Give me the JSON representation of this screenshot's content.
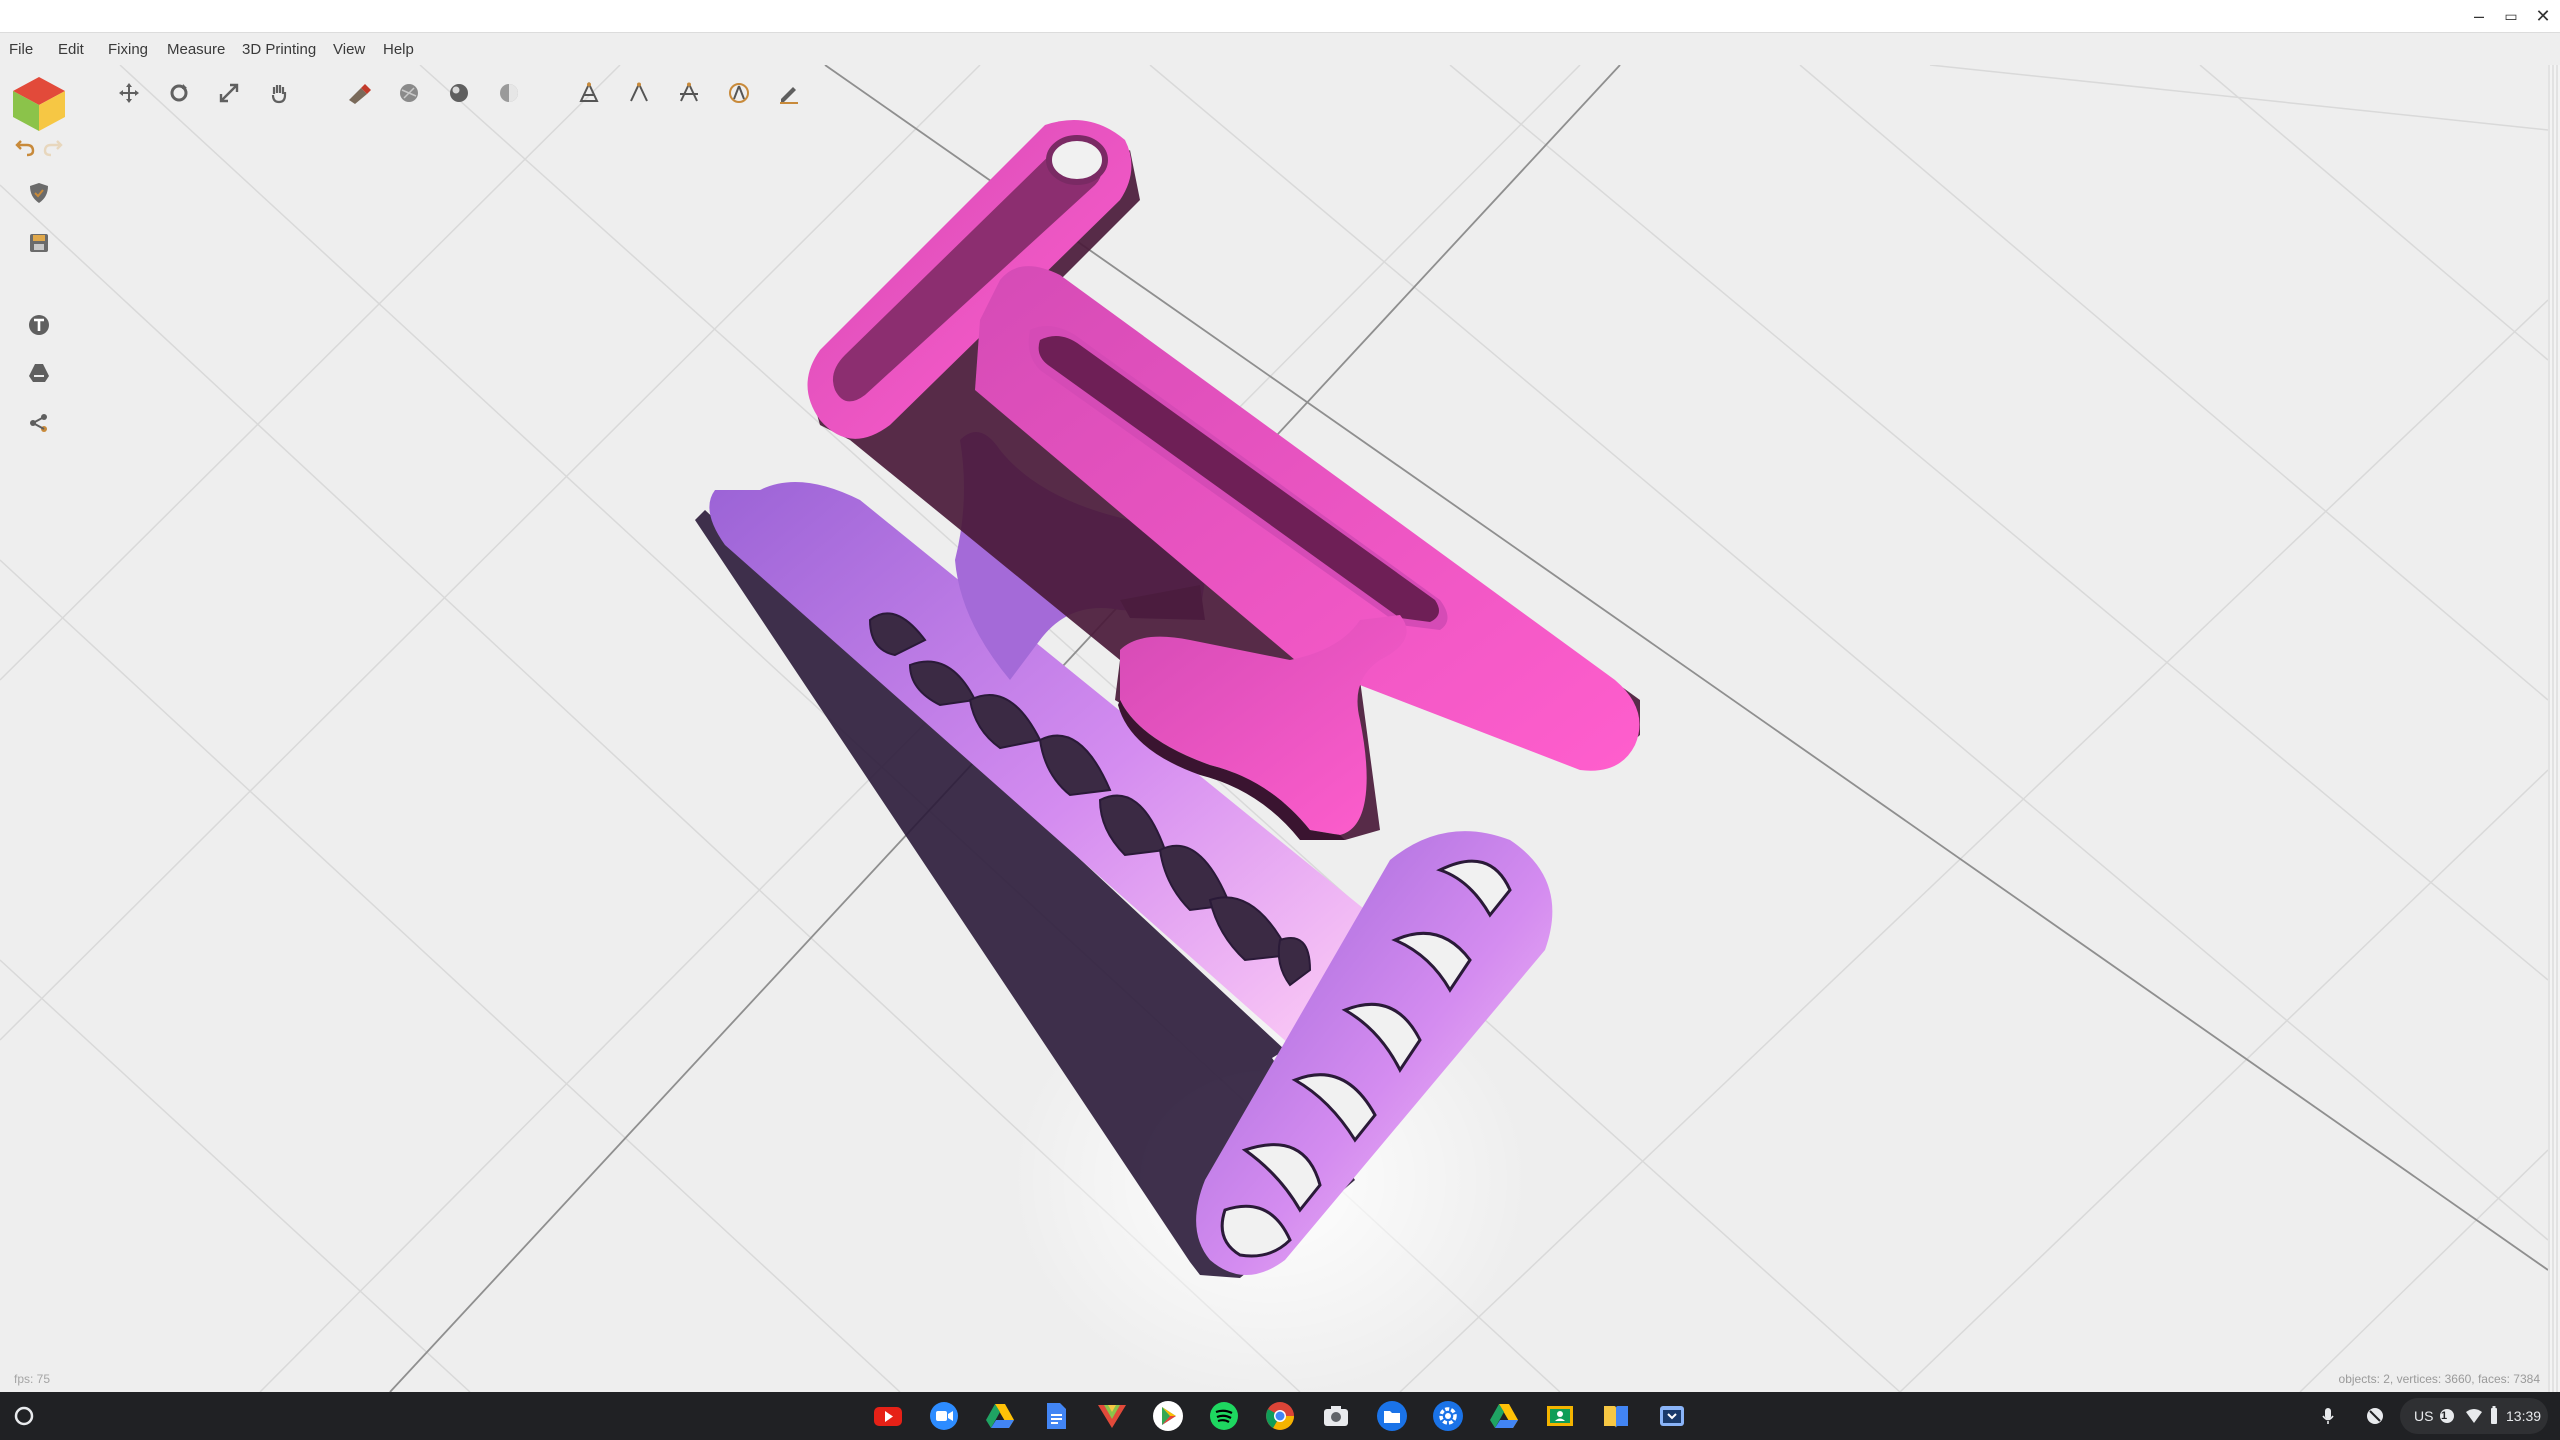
{
  "menu": [
    "File",
    "Edit",
    "Fixing",
    "Measure",
    "3D Printing",
    "View",
    "Help"
  ],
  "window_controls": {
    "minimize": "–",
    "restore": "▭",
    "close": "✕"
  },
  "left_tools": [
    "logo-cube",
    "undo",
    "redo",
    "repair",
    "save",
    "text",
    "drive",
    "share"
  ],
  "toolbar_groups": [
    [
      "move-icon",
      "rotate-icon",
      "scale-icon",
      "hand-icon"
    ],
    [
      "paint-icon",
      "sphere-flat-icon",
      "sphere-shaded-icon",
      "sphere-half-icon"
    ],
    [
      "measure-a-icon",
      "measure-b-icon",
      "measure-c-icon",
      "measure-d-icon",
      "pencil-icon"
    ]
  ],
  "status": {
    "fps": "fps: 75",
    "stats": "objects: 2, vertices: 3660, faces: 7384"
  },
  "shelf": {
    "apps": [
      "youtube",
      "zoom",
      "drive",
      "docs",
      "app-3d",
      "play-store",
      "spotify",
      "chrome",
      "camera",
      "files",
      "settings",
      "drive-2",
      "classroom",
      "books",
      "tab-app"
    ],
    "tray": {
      "lang": "US",
      "badge": "1",
      "time": "13:39"
    }
  },
  "colors": {
    "pink": "#e94fb9",
    "purple": "#a470dc",
    "light_pink": "#f7b7ee"
  }
}
